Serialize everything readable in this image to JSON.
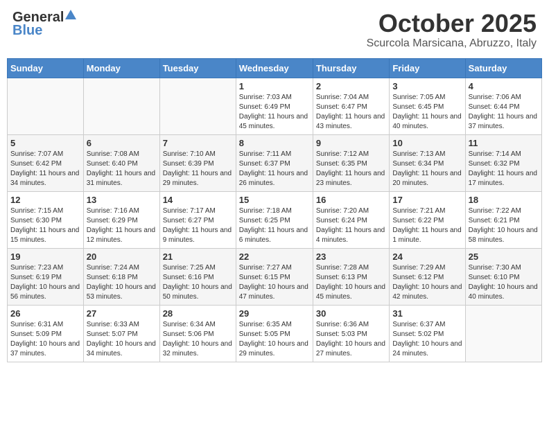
{
  "header": {
    "logo_general": "General",
    "logo_blue": "Blue",
    "month_title": "October 2025",
    "location": "Scurcola Marsicana, Abruzzo, Italy"
  },
  "weekdays": [
    "Sunday",
    "Monday",
    "Tuesday",
    "Wednesday",
    "Thursday",
    "Friday",
    "Saturday"
  ],
  "weeks": [
    [
      {
        "day": "",
        "sunrise": "",
        "sunset": "",
        "daylight": ""
      },
      {
        "day": "",
        "sunrise": "",
        "sunset": "",
        "daylight": ""
      },
      {
        "day": "",
        "sunrise": "",
        "sunset": "",
        "daylight": ""
      },
      {
        "day": "1",
        "sunrise": "Sunrise: 7:03 AM",
        "sunset": "Sunset: 6:49 PM",
        "daylight": "Daylight: 11 hours and 45 minutes."
      },
      {
        "day": "2",
        "sunrise": "Sunrise: 7:04 AM",
        "sunset": "Sunset: 6:47 PM",
        "daylight": "Daylight: 11 hours and 43 minutes."
      },
      {
        "day": "3",
        "sunrise": "Sunrise: 7:05 AM",
        "sunset": "Sunset: 6:45 PM",
        "daylight": "Daylight: 11 hours and 40 minutes."
      },
      {
        "day": "4",
        "sunrise": "Sunrise: 7:06 AM",
        "sunset": "Sunset: 6:44 PM",
        "daylight": "Daylight: 11 hours and 37 minutes."
      }
    ],
    [
      {
        "day": "5",
        "sunrise": "Sunrise: 7:07 AM",
        "sunset": "Sunset: 6:42 PM",
        "daylight": "Daylight: 11 hours and 34 minutes."
      },
      {
        "day": "6",
        "sunrise": "Sunrise: 7:08 AM",
        "sunset": "Sunset: 6:40 PM",
        "daylight": "Daylight: 11 hours and 31 minutes."
      },
      {
        "day": "7",
        "sunrise": "Sunrise: 7:10 AM",
        "sunset": "Sunset: 6:39 PM",
        "daylight": "Daylight: 11 hours and 29 minutes."
      },
      {
        "day": "8",
        "sunrise": "Sunrise: 7:11 AM",
        "sunset": "Sunset: 6:37 PM",
        "daylight": "Daylight: 11 hours and 26 minutes."
      },
      {
        "day": "9",
        "sunrise": "Sunrise: 7:12 AM",
        "sunset": "Sunset: 6:35 PM",
        "daylight": "Daylight: 11 hours and 23 minutes."
      },
      {
        "day": "10",
        "sunrise": "Sunrise: 7:13 AM",
        "sunset": "Sunset: 6:34 PM",
        "daylight": "Daylight: 11 hours and 20 minutes."
      },
      {
        "day": "11",
        "sunrise": "Sunrise: 7:14 AM",
        "sunset": "Sunset: 6:32 PM",
        "daylight": "Daylight: 11 hours and 17 minutes."
      }
    ],
    [
      {
        "day": "12",
        "sunrise": "Sunrise: 7:15 AM",
        "sunset": "Sunset: 6:30 PM",
        "daylight": "Daylight: 11 hours and 15 minutes."
      },
      {
        "day": "13",
        "sunrise": "Sunrise: 7:16 AM",
        "sunset": "Sunset: 6:29 PM",
        "daylight": "Daylight: 11 hours and 12 minutes."
      },
      {
        "day": "14",
        "sunrise": "Sunrise: 7:17 AM",
        "sunset": "Sunset: 6:27 PM",
        "daylight": "Daylight: 11 hours and 9 minutes."
      },
      {
        "day": "15",
        "sunrise": "Sunrise: 7:18 AM",
        "sunset": "Sunset: 6:25 PM",
        "daylight": "Daylight: 11 hours and 6 minutes."
      },
      {
        "day": "16",
        "sunrise": "Sunrise: 7:20 AM",
        "sunset": "Sunset: 6:24 PM",
        "daylight": "Daylight: 11 hours and 4 minutes."
      },
      {
        "day": "17",
        "sunrise": "Sunrise: 7:21 AM",
        "sunset": "Sunset: 6:22 PM",
        "daylight": "Daylight: 11 hours and 1 minute."
      },
      {
        "day": "18",
        "sunrise": "Sunrise: 7:22 AM",
        "sunset": "Sunset: 6:21 PM",
        "daylight": "Daylight: 10 hours and 58 minutes."
      }
    ],
    [
      {
        "day": "19",
        "sunrise": "Sunrise: 7:23 AM",
        "sunset": "Sunset: 6:19 PM",
        "daylight": "Daylight: 10 hours and 56 minutes."
      },
      {
        "day": "20",
        "sunrise": "Sunrise: 7:24 AM",
        "sunset": "Sunset: 6:18 PM",
        "daylight": "Daylight: 10 hours and 53 minutes."
      },
      {
        "day": "21",
        "sunrise": "Sunrise: 7:25 AM",
        "sunset": "Sunset: 6:16 PM",
        "daylight": "Daylight: 10 hours and 50 minutes."
      },
      {
        "day": "22",
        "sunrise": "Sunrise: 7:27 AM",
        "sunset": "Sunset: 6:15 PM",
        "daylight": "Daylight: 10 hours and 47 minutes."
      },
      {
        "day": "23",
        "sunrise": "Sunrise: 7:28 AM",
        "sunset": "Sunset: 6:13 PM",
        "daylight": "Daylight: 10 hours and 45 minutes."
      },
      {
        "day": "24",
        "sunrise": "Sunrise: 7:29 AM",
        "sunset": "Sunset: 6:12 PM",
        "daylight": "Daylight: 10 hours and 42 minutes."
      },
      {
        "day": "25",
        "sunrise": "Sunrise: 7:30 AM",
        "sunset": "Sunset: 6:10 PM",
        "daylight": "Daylight: 10 hours and 40 minutes."
      }
    ],
    [
      {
        "day": "26",
        "sunrise": "Sunrise: 6:31 AM",
        "sunset": "Sunset: 5:09 PM",
        "daylight": "Daylight: 10 hours and 37 minutes."
      },
      {
        "day": "27",
        "sunrise": "Sunrise: 6:33 AM",
        "sunset": "Sunset: 5:07 PM",
        "daylight": "Daylight: 10 hours and 34 minutes."
      },
      {
        "day": "28",
        "sunrise": "Sunrise: 6:34 AM",
        "sunset": "Sunset: 5:06 PM",
        "daylight": "Daylight: 10 hours and 32 minutes."
      },
      {
        "day": "29",
        "sunrise": "Sunrise: 6:35 AM",
        "sunset": "Sunset: 5:05 PM",
        "daylight": "Daylight: 10 hours and 29 minutes."
      },
      {
        "day": "30",
        "sunrise": "Sunrise: 6:36 AM",
        "sunset": "Sunset: 5:03 PM",
        "daylight": "Daylight: 10 hours and 27 minutes."
      },
      {
        "day": "31",
        "sunrise": "Sunrise: 6:37 AM",
        "sunset": "Sunset: 5:02 PM",
        "daylight": "Daylight: 10 hours and 24 minutes."
      },
      {
        "day": "",
        "sunrise": "",
        "sunset": "",
        "daylight": ""
      }
    ]
  ]
}
